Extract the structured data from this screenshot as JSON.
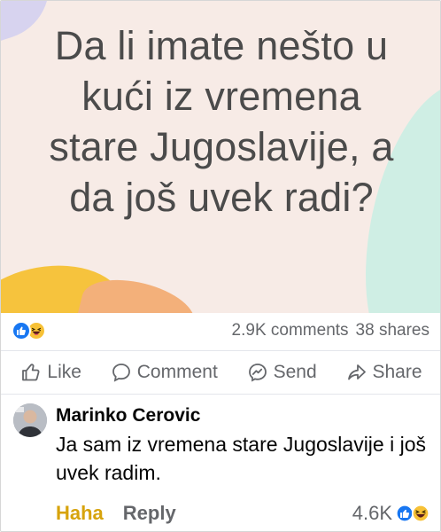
{
  "post": {
    "text": "Da li imate nešto u kući iz vremena stare Jugoslavije, a da još uvek radi?"
  },
  "stats": {
    "reactions": [
      "like-icon",
      "haha-icon"
    ],
    "comments": "2.9K comments",
    "shares": "38 shares"
  },
  "actions": {
    "like": "Like",
    "comment": "Comment",
    "send": "Send",
    "share": "Share"
  },
  "comment": {
    "author": "Marinko Cerovic",
    "text": "Ja sam iz vremena stare Jugoslavije i još uvek radim.",
    "reaction_label": "Haha",
    "reply_label": "Reply",
    "reaction_count": "4.6K",
    "reactions": [
      "like-icon",
      "haha-icon"
    ]
  },
  "colors": {
    "card_bg": "#f7ebe6",
    "post_text": "#4b4b4b",
    "like_blue": "#1877f2",
    "haha_yellow": "#f7c136",
    "haha_label": "#d7a30c",
    "meta_gray": "#65676b"
  }
}
